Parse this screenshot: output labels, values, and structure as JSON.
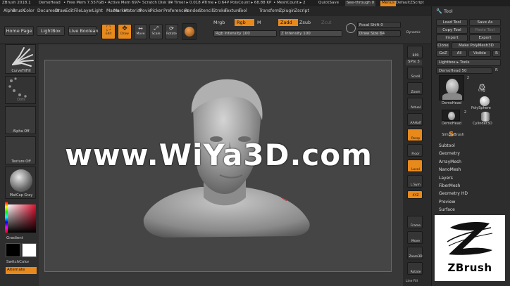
{
  "titlebar": {
    "app": "ZBrush 2018.1",
    "project": "DemoHead",
    "free_mem": "• Free Mem 7.557GB",
    "active_mem": "• Active Mem 697",
    "scratch": "• Scratch Disk 90",
    "timer": "• Timer ▸ 0.018 ATime ▸ 0.647",
    "polycount": "• PolyCount ▸ 68.88 KP",
    "meshcount": "• MeshCount ▸ 2",
    "quicksave": "QuickSave",
    "see_through": "See-through  0",
    "menus": "Menus",
    "zscript": "DefaultZScript"
  },
  "menubar": [
    "Alpha",
    "Brush",
    "Color",
    "Document",
    "Draw",
    "Edit",
    "File",
    "Layer",
    "Light",
    "Macro",
    "Marker",
    "Material",
    "Movie",
    "Picker",
    "Preferences",
    "Render",
    "Stencil",
    "Stroke",
    "Texture",
    "Tool",
    "Transform",
    "Zplugin",
    "Zscript"
  ],
  "shelf": {
    "home": "Home Page",
    "lightbox": "LightBox",
    "live_boolean": "Live Boolean",
    "edit": "Edit",
    "draw": "Draw",
    "move": "Move",
    "scale": "Scale",
    "rotate": "Rotate",
    "mrgb": "Mrgb",
    "rgb": "Rgb",
    "m": "M",
    "zadd": "Zadd",
    "zsub": "Zsub",
    "zcut": "Zcut",
    "rgb_intensity": "Rgb Intensity 100",
    "z_intensity": "Z Intensity 100",
    "focal_shift": "Focal Shift 0",
    "draw_size": "Draw Size 64",
    "dynamic": "Dynamic"
  },
  "left": {
    "brush": "CurveTriFill",
    "stroke": "Dots",
    "alpha": "Alpha Off",
    "texture": "Texture Off",
    "material": "MatCap Gray",
    "gradient": "Gradient",
    "switchcolor": "SwitchColor",
    "alternate": "Alternate"
  },
  "right": {
    "bpr": "BPR",
    "spix": "SPix 3",
    "scroll": "Scroll",
    "zoom": "Zoom",
    "actual": "Actual",
    "aahalf": "AAHalf",
    "persp": "Persp",
    "floor": "Floor",
    "local": "Local",
    "lsym": "L.Sym",
    "xyz": "XYZ",
    "frame": "Frame",
    "move": "Move",
    "zoom3d": "Zoom3D",
    "rotate": "Rotate",
    "linefill": "Line Fill"
  },
  "tool": {
    "title": "Tool",
    "load": "Load Tool",
    "save": "Save As",
    "copy": "Copy Tool",
    "paste": "Paste Tool",
    "import": "Import",
    "export": "Export",
    "clone": "Clone",
    "make_poly": "Make PolyMesh3D",
    "goz": "GoZ",
    "all": "All",
    "visible": "Visible",
    "r": "R",
    "lightbox_tools": "Lightbox ▸ Tools",
    "demohead_slider": "DemoHead  50",
    "r2": "R",
    "thumbs": [
      {
        "label": "DemoHead",
        "count": "2"
      },
      {
        "label": "Cog",
        "count": ""
      },
      {
        "label": "PolySphere",
        "count": ""
      },
      {
        "label": "DemoHead",
        "count": "2"
      },
      {
        "label": "Cylinder3D",
        "count": ""
      },
      {
        "label": "SimpleBrush",
        "count": ""
      }
    ],
    "subpalettes": [
      "Subtool",
      "Geometry",
      "ArrayMesh",
      "NanoMesh",
      "Layers",
      "FiberMesh",
      "Geometry HD",
      "Preview",
      "Surface"
    ]
  },
  "watermark": "www.WiYa3D.com",
  "logo_text": "ZBrush",
  "colors": {
    "accent": "#e8891c",
    "bg": "#2b2b2b"
  }
}
